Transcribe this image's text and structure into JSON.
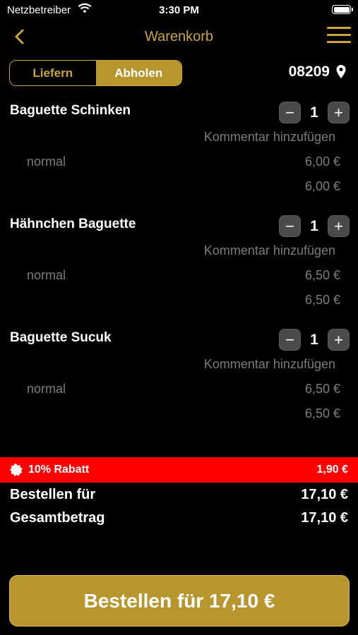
{
  "status": {
    "carrier": "Netzbetreiber",
    "time": "3:30 PM"
  },
  "nav": {
    "title": "Warenkorb"
  },
  "mode": {
    "deliver": "Liefern",
    "pickup": "Abholen"
  },
  "location": {
    "zip": "08209"
  },
  "cart": {
    "items": [
      {
        "name": "Baguette Schinken",
        "qty": "1",
        "comment": "Kommentar hinzufügen",
        "variant": "normal",
        "price": "6,00 €",
        "total": "6,00 €"
      },
      {
        "name": "Hähnchen Baguette",
        "qty": "1",
        "comment": "Kommentar hinzufügen",
        "variant": "normal",
        "price": "6,50 €",
        "total": "6,50 €"
      },
      {
        "name": "Baguette Sucuk",
        "qty": "1",
        "comment": "Kommentar hinzufügen",
        "variant": "normal",
        "price": "6,50 €",
        "total": "6,50 €"
      }
    ],
    "minus": "−",
    "plus": "+"
  },
  "discount": {
    "label": "10% Rabatt",
    "amount": "1,90 €"
  },
  "summary": {
    "order_label": "Bestellen für",
    "order_value": "17,10 €",
    "total_label": "Gesamtbetrag",
    "total_value": "17,10 €"
  },
  "cta": {
    "label": "Bestellen für 17,10 €"
  },
  "colors": {
    "accent": "#c9a53c",
    "button": "#b8962e",
    "discount": "#ff0000",
    "muted": "#7c7c7c"
  }
}
